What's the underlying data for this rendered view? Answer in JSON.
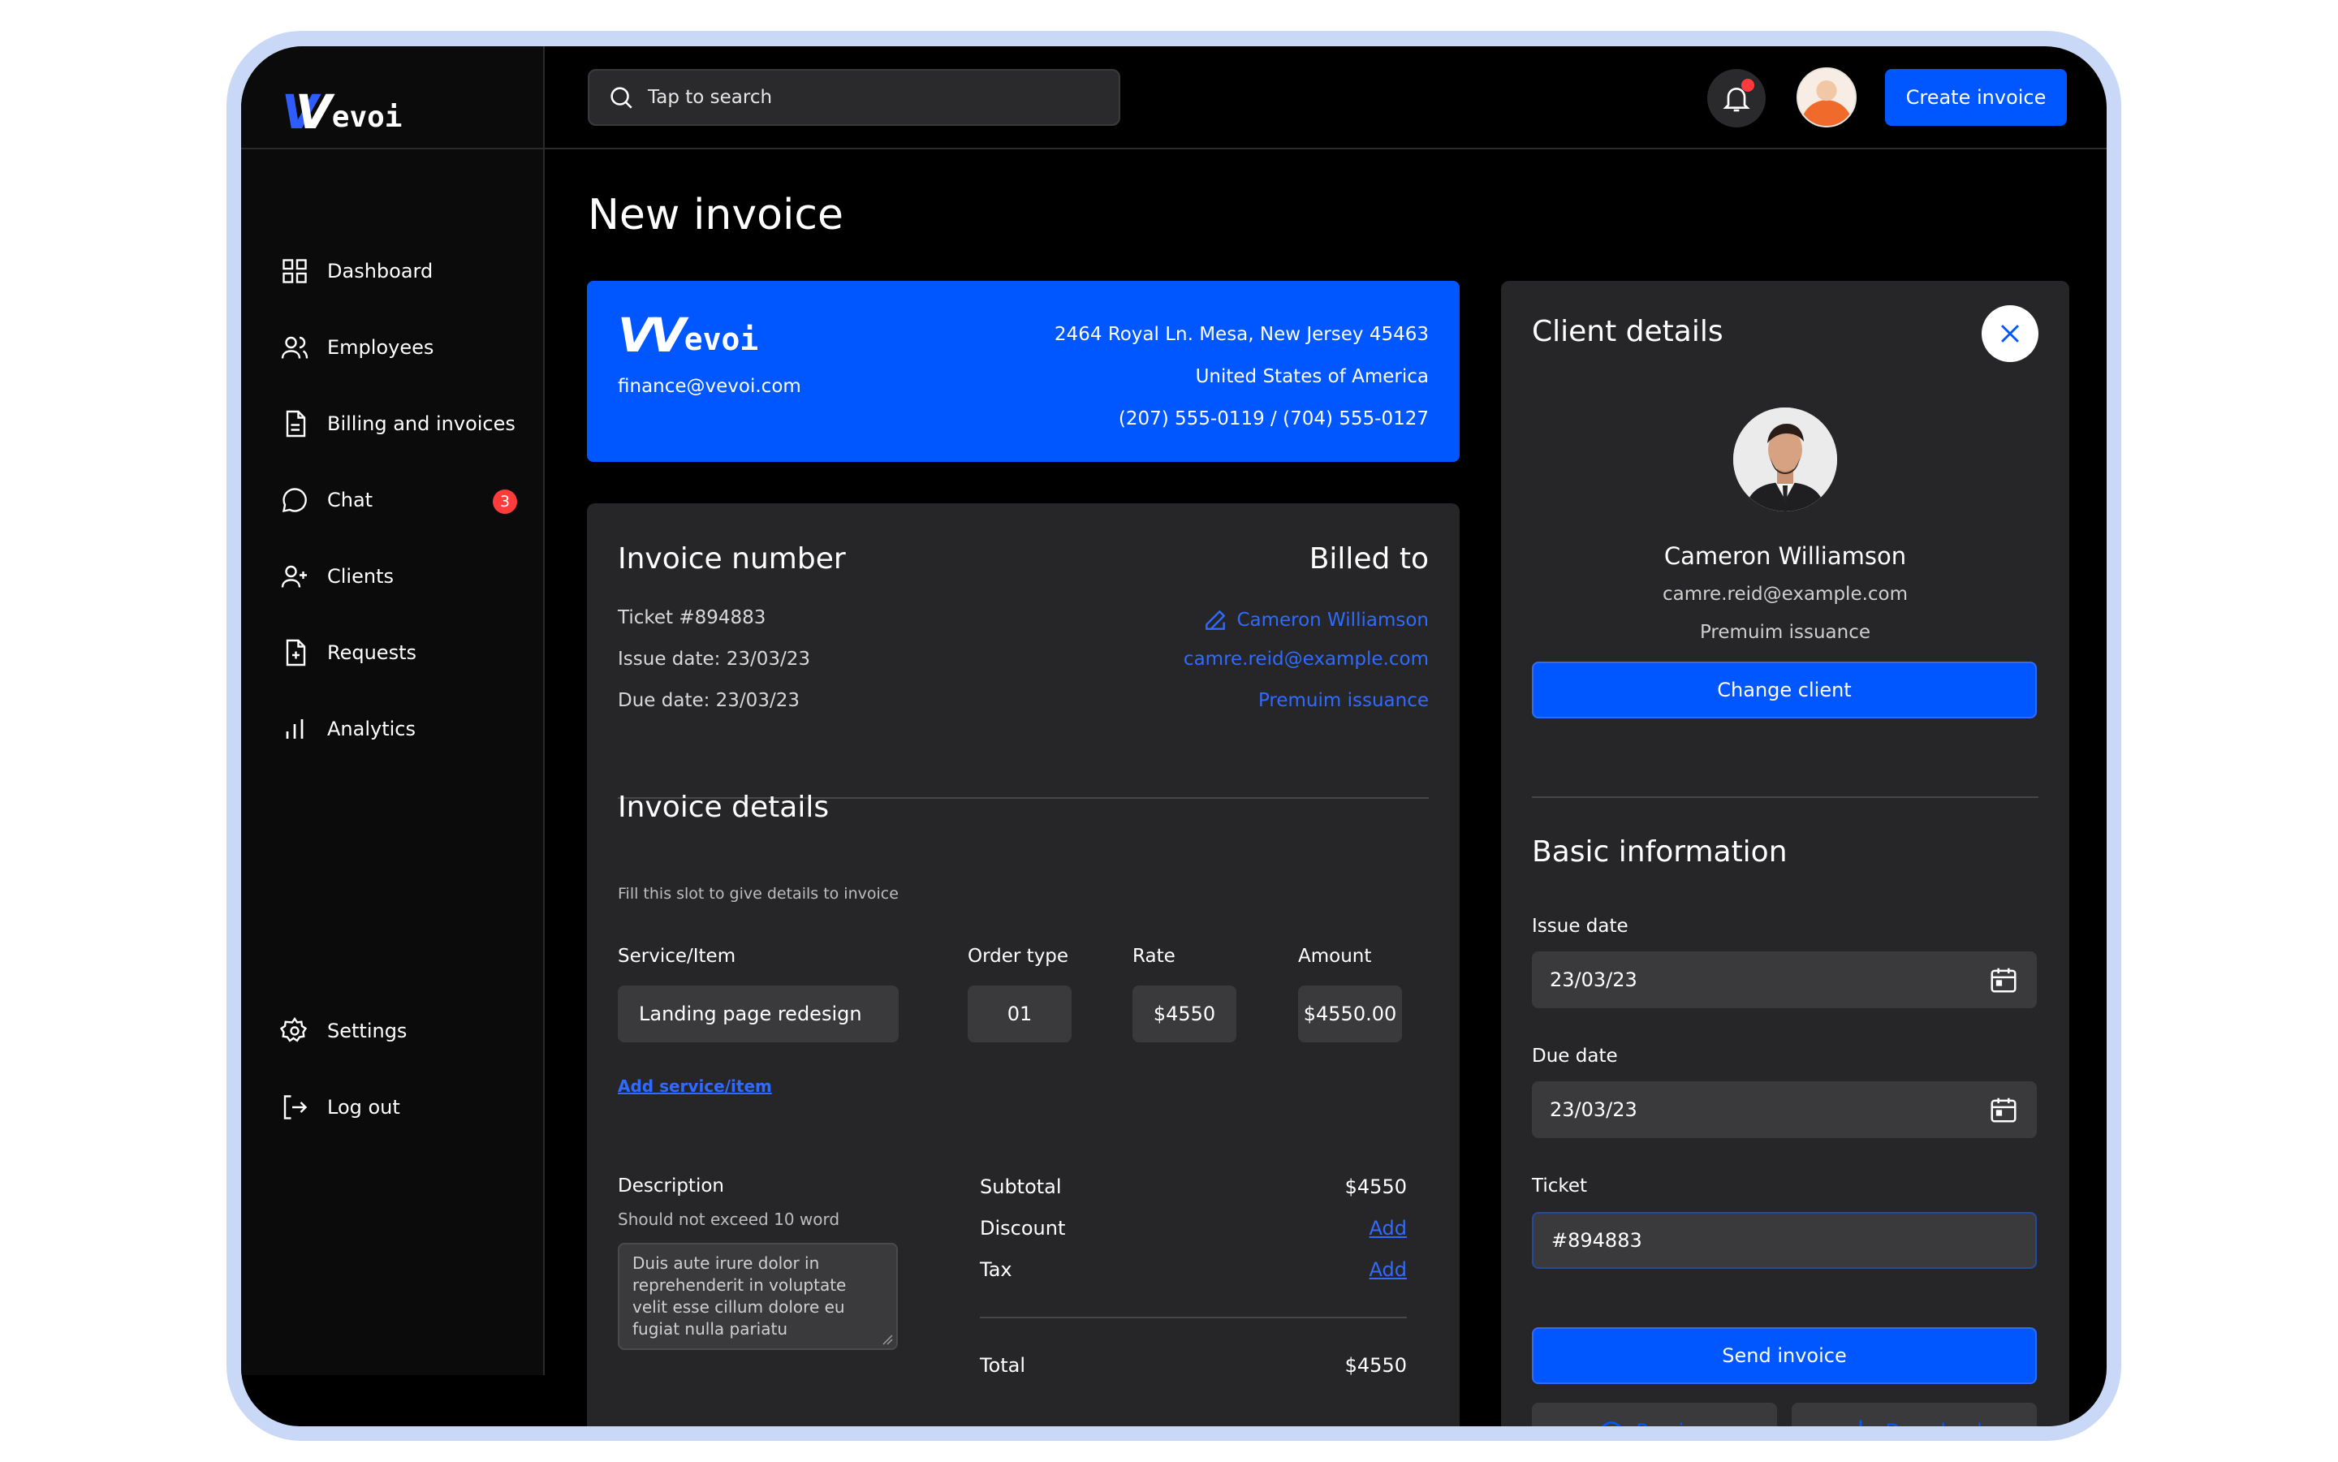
{
  "brand": {
    "logo_text": "evoi"
  },
  "sidebar": {
    "items": [
      {
        "label": "Dashboard",
        "icon": "grid-icon"
      },
      {
        "label": "Employees",
        "icon": "users-icon"
      },
      {
        "label": "Billing and invoices",
        "icon": "document-icon"
      },
      {
        "label": "Chat",
        "icon": "chat-icon",
        "badge": "3"
      },
      {
        "label": "Clients",
        "icon": "user-plus-icon"
      },
      {
        "label": "Requests",
        "icon": "file-plus-icon"
      },
      {
        "label": "Analytics",
        "icon": "bar-chart-icon"
      }
    ],
    "bottom_items": [
      {
        "label": "Settings",
        "icon": "gear-icon"
      },
      {
        "label": "Log out",
        "icon": "logout-icon"
      }
    ]
  },
  "header": {
    "search_placeholder": "Tap to search",
    "create_button": "Create invoice"
  },
  "page": {
    "title": "New invoice"
  },
  "company_card": {
    "email": "finance@vevoi.com",
    "address_line1": "2464 Royal Ln. Mesa, New Jersey 45463",
    "address_line2": "United States of America",
    "phones": "(207) 555-0119 / (704) 555-0127"
  },
  "invoice": {
    "number_heading": "Invoice number",
    "ticket": "Ticket #894883",
    "issue_date": "Issue date: 23/03/23",
    "due_date": "Due date: 23/03/23",
    "billed_heading": "Billed to",
    "billed_name": "Cameron Williamson",
    "billed_email": "camre.reid@example.com",
    "billed_plan": "Premuim issuance",
    "details_heading": "Invoice details",
    "details_hint": "Fill this slot to give details to invoice",
    "columns": {
      "service": "Service/Item",
      "order_type": "Order type",
      "rate": "Rate",
      "amount": "Amount"
    },
    "item": {
      "service": "Landing page redesign",
      "order_type": "01",
      "rate": "$4550",
      "amount": "$4550.00"
    },
    "add_item": "Add service/item",
    "description_label": "Description",
    "description_hint": "Should not exceed 10 word",
    "description_text": "Duis aute irure dolor in reprehenderit in voluptate velit esse cillum dolore eu fugiat nulla pariatu",
    "subtotal_label": "Subtotal",
    "subtotal_value": "$4550",
    "discount_label": "Discount",
    "discount_action": "Add",
    "tax_label": "Tax",
    "tax_action": "Add",
    "total_label": "Total",
    "total_value": "$4550"
  },
  "client_panel": {
    "heading": "Client details",
    "name": "Cameron Williamson",
    "email": "camre.reid@example.com",
    "plan": "Premuim issuance",
    "change_button": "Change client",
    "basic_heading": "Basic information",
    "issue_label": "Issue date",
    "issue_value": "23/03/23",
    "due_label": "Due date",
    "due_value": "23/03/23",
    "ticket_label": "Ticket",
    "ticket_value": "#894883",
    "send_button": "Send invoice",
    "preview_button": "Preview",
    "download_button": "Download"
  },
  "colors": {
    "accent": "#0057ff",
    "badge": "#ff3b3b",
    "panel": "#262628",
    "background": "#000000"
  }
}
